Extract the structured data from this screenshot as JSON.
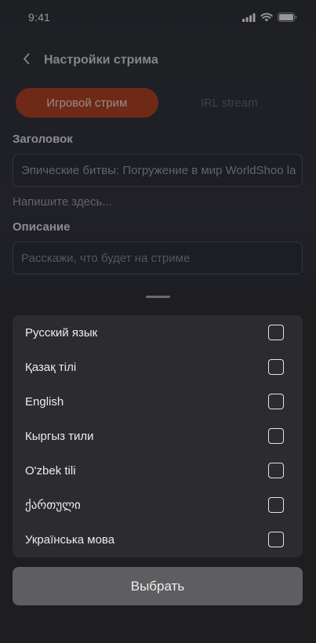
{
  "status_bar": {
    "time": "9:41",
    "icons": [
      "cellular-signal-icon",
      "wifi-icon",
      "battery-icon"
    ]
  },
  "header": {
    "back_icon": "chevron-left-icon",
    "title": "Настройки стрима"
  },
  "stream_type_tabs": [
    {
      "label": "Игровой стрим",
      "active": true
    },
    {
      "label": "IRL stream",
      "active": false
    }
  ],
  "form": {
    "title_label": "Заголовок",
    "title_value": "Эпические битвы: Погружение в мир WorldShoo la",
    "title_hint": "Напишите здесь...",
    "description_label": "Описание",
    "description_placeholder": "Расскажи, что будет на стриме"
  },
  "language_sheet": {
    "languages": [
      {
        "label": "Русский язык",
        "checked": false
      },
      {
        "label": "Қазақ тілі",
        "checked": false
      },
      {
        "label": "English",
        "checked": false
      },
      {
        "label": "Кыргыз тили",
        "checked": false
      },
      {
        "label": "O'zbek tili",
        "checked": false
      },
      {
        "label": "ქართული",
        "checked": false
      },
      {
        "label": "Українська мова",
        "checked": false
      }
    ],
    "confirm_label": "Выбрать"
  },
  "colors": {
    "accent": "#a03c22",
    "sheet_background": "#1e1e20",
    "list_background": "#2c2c2e",
    "button_background": "#5e5e60"
  }
}
